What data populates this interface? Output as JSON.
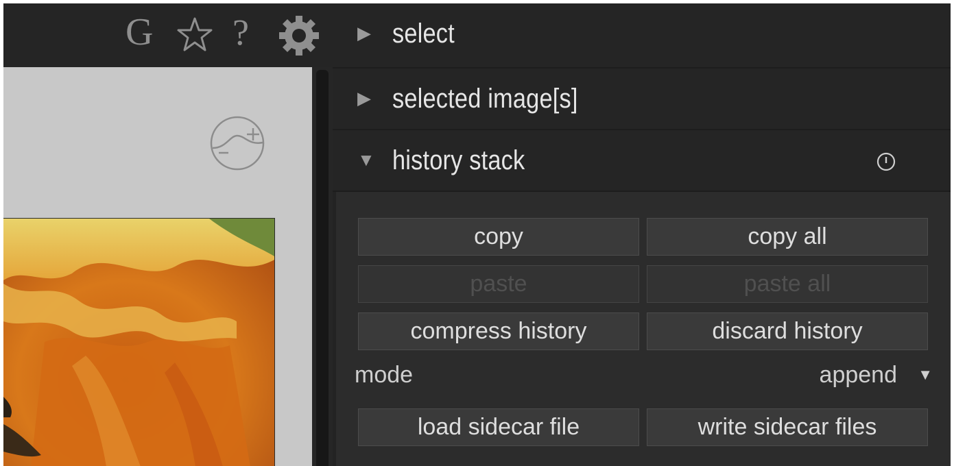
{
  "toolbar": {
    "icons": [
      "G",
      "star-icon",
      "?",
      "gear-icon"
    ],
    "grouping_label": "G",
    "help_label": "?"
  },
  "panels": {
    "select": {
      "label": "select",
      "arrow": "▶"
    },
    "selected_images": {
      "label": "selected image[s]",
      "arrow": "▶"
    },
    "history_stack": {
      "label": "history stack",
      "arrow": "▼"
    }
  },
  "history": {
    "copy": "copy",
    "copy_all": "copy all",
    "paste": "paste",
    "paste_all": "paste all",
    "compress": "compress history",
    "discard": "discard history",
    "mode_label": "mode",
    "mode_value": "append",
    "mode_arrow": "▼",
    "load_sidecar": "load sidecar file",
    "write_sidecar": "write sidecar files"
  },
  "colors": {
    "panel_bg": "#232323",
    "header_bg": "#252525",
    "button_bg": "#3a3a3a",
    "text": "#e6e6e6",
    "disabled_text": "#505050",
    "center_bg": "#c8c8c8"
  }
}
